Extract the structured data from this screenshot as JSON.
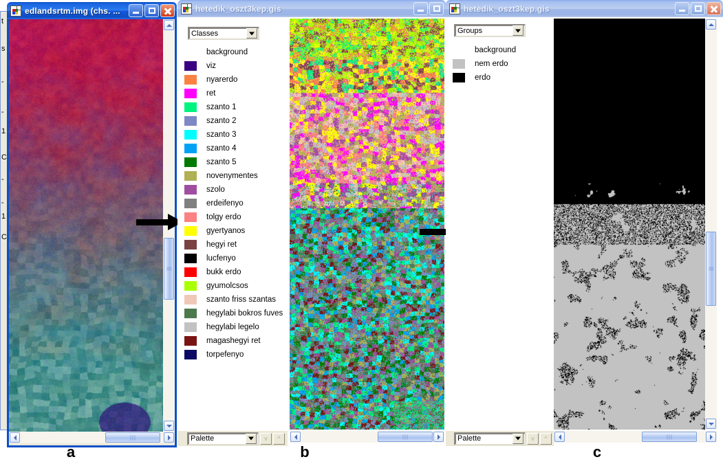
{
  "windows": [
    {
      "id": "win-a",
      "title": "edlandsrtm.img (chs. ...",
      "active": true,
      "caption": "a",
      "controls": {
        "minimize": "Minimize",
        "maximize": "Maximize",
        "close": "Close"
      }
    },
    {
      "id": "win-b",
      "title": "hetedik_oszt3kep.gis",
      "active": false,
      "caption": "b",
      "controls": {
        "minimize": "Minimize",
        "maximize": "Maximize",
        "close": "Close"
      }
    },
    {
      "id": "win-c",
      "title": "hetedik_oszt3kep.gis",
      "active": false,
      "caption": "c",
      "controls": {
        "minimize": "Minimize",
        "maximize": "Maximize",
        "close": "Close"
      }
    }
  ],
  "classes_panel": {
    "selector_value": "Classes",
    "palette_value": "Palette",
    "items": [
      {
        "label": "background",
        "color": "none"
      },
      {
        "label": "viz",
        "color": "#3a0082"
      },
      {
        "label": "nyarerdo",
        "color": "#fb8243"
      },
      {
        "label": "ret",
        "color": "#ff00ff"
      },
      {
        "label": "szanto 1",
        "color": "#00f47e"
      },
      {
        "label": "szanto 2",
        "color": "#7e88c4"
      },
      {
        "label": "szanto 3",
        "color": "#00ffff"
      },
      {
        "label": "szanto 4",
        "color": "#00a2f5"
      },
      {
        "label": "szanto 5",
        "color": "#007a00"
      },
      {
        "label": "novenymentes",
        "color": "#b0b055"
      },
      {
        "label": "szolo",
        "color": "#a04fa0"
      },
      {
        "label": "erdeifenyo",
        "color": "#808080"
      },
      {
        "label": "tolgy erdo",
        "color": "#fb8282"
      },
      {
        "label": "gyertyanos",
        "color": "#ffff00"
      },
      {
        "label": "hegyi ret",
        "color": "#7a4242"
      },
      {
        "label": "lucfenyo",
        "color": "#000000"
      },
      {
        "label": "bukk erdo",
        "color": "#ff0000"
      },
      {
        "label": "gyumolcsos",
        "color": "#aaff00"
      },
      {
        "label": "szanto friss szantas",
        "color": "#f0c8b8"
      },
      {
        "label": "hegylabi bokros fuves",
        "color": "#4d7a4d"
      },
      {
        "label": "hegylabi legelo",
        "color": "#c2c2c2"
      },
      {
        "label": "magashegyi ret",
        "color": "#7a1414"
      },
      {
        "label": "torpefenyo",
        "color": "#0a0a64"
      }
    ]
  },
  "groups_panel": {
    "selector_value": "Groups",
    "palette_value": "Palette",
    "items": [
      {
        "label": "background",
        "color": "none"
      },
      {
        "label": "nem erdo",
        "color": "#c2c2c2"
      },
      {
        "label": "erdo",
        "color": "#000000"
      }
    ]
  },
  "captions": {
    "a": "a",
    "b": "b",
    "c": "c"
  },
  "background_window_fragments": [
    "t",
    "s",
    "-",
    "-",
    "1",
    "C",
    "-",
    "-",
    "1",
    "C"
  ],
  "theme": {
    "active_title": "#1b64e0",
    "inactive_title": "#a6c0f0",
    "panel_bg": "#ece9d8",
    "white": "#ffffff"
  }
}
